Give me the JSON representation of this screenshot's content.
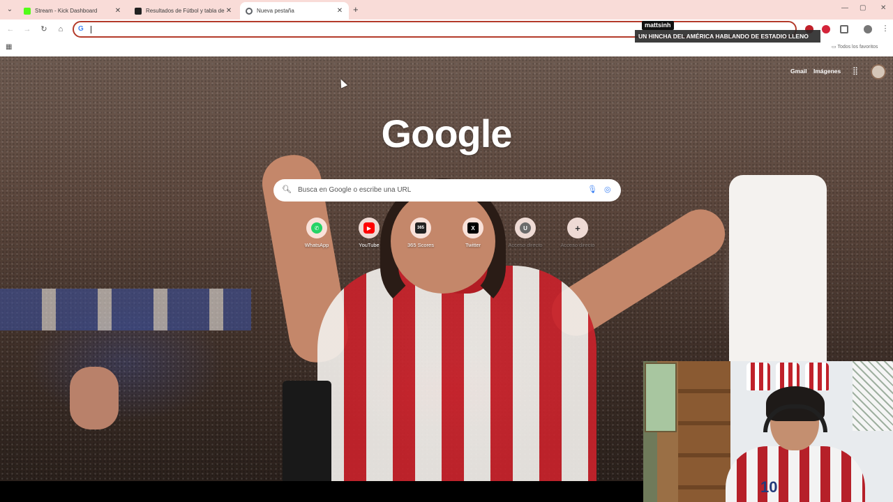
{
  "tabs": [
    {
      "title": "Stream - Kick Dashboard",
      "favicon_color": "#53fc18",
      "active": false
    },
    {
      "title": "Resultados de Fútbol y tabla de",
      "favicon_color": "#222222",
      "active": false
    },
    {
      "title": "Nueva pestaña",
      "favicon_color": "#5f6368",
      "active": true
    }
  ],
  "toolbar": {
    "omnibox_value": "",
    "bookmarks_folder": "Todos los favoritos"
  },
  "overlay": {
    "username": "mattsinh",
    "message": "UN HINCHA DEL AMÉRICA HABLANDO DE ESTADIO LLENO"
  },
  "ntp": {
    "links": {
      "gmail": "Gmail",
      "images": "Imágenes"
    },
    "logo": "Google",
    "search_placeholder": "Busca en Google o escribe una URL",
    "shortcuts": [
      {
        "label": "WhatsApp",
        "icon": "whatsapp-icon",
        "color": "#25d366",
        "glyph": "✆"
      },
      {
        "label": "YouTube",
        "icon": "youtube-icon",
        "color": "#ff0000",
        "glyph": "▶"
      },
      {
        "label": "365 Scores",
        "icon": "365scores-icon",
        "color": "#222222",
        "glyph": "365"
      },
      {
        "label": "Twitter",
        "icon": "x-icon",
        "color": "#000000",
        "glyph": "X"
      },
      {
        "label": "Acceso directo",
        "icon": "u-icon",
        "color": "#6b6b6b",
        "glyph": "U"
      },
      {
        "label": "Acceso directo",
        "icon": "add-icon",
        "color": "transparent",
        "glyph": "+"
      }
    ]
  },
  "webcam": {
    "jersey_number": "10"
  }
}
